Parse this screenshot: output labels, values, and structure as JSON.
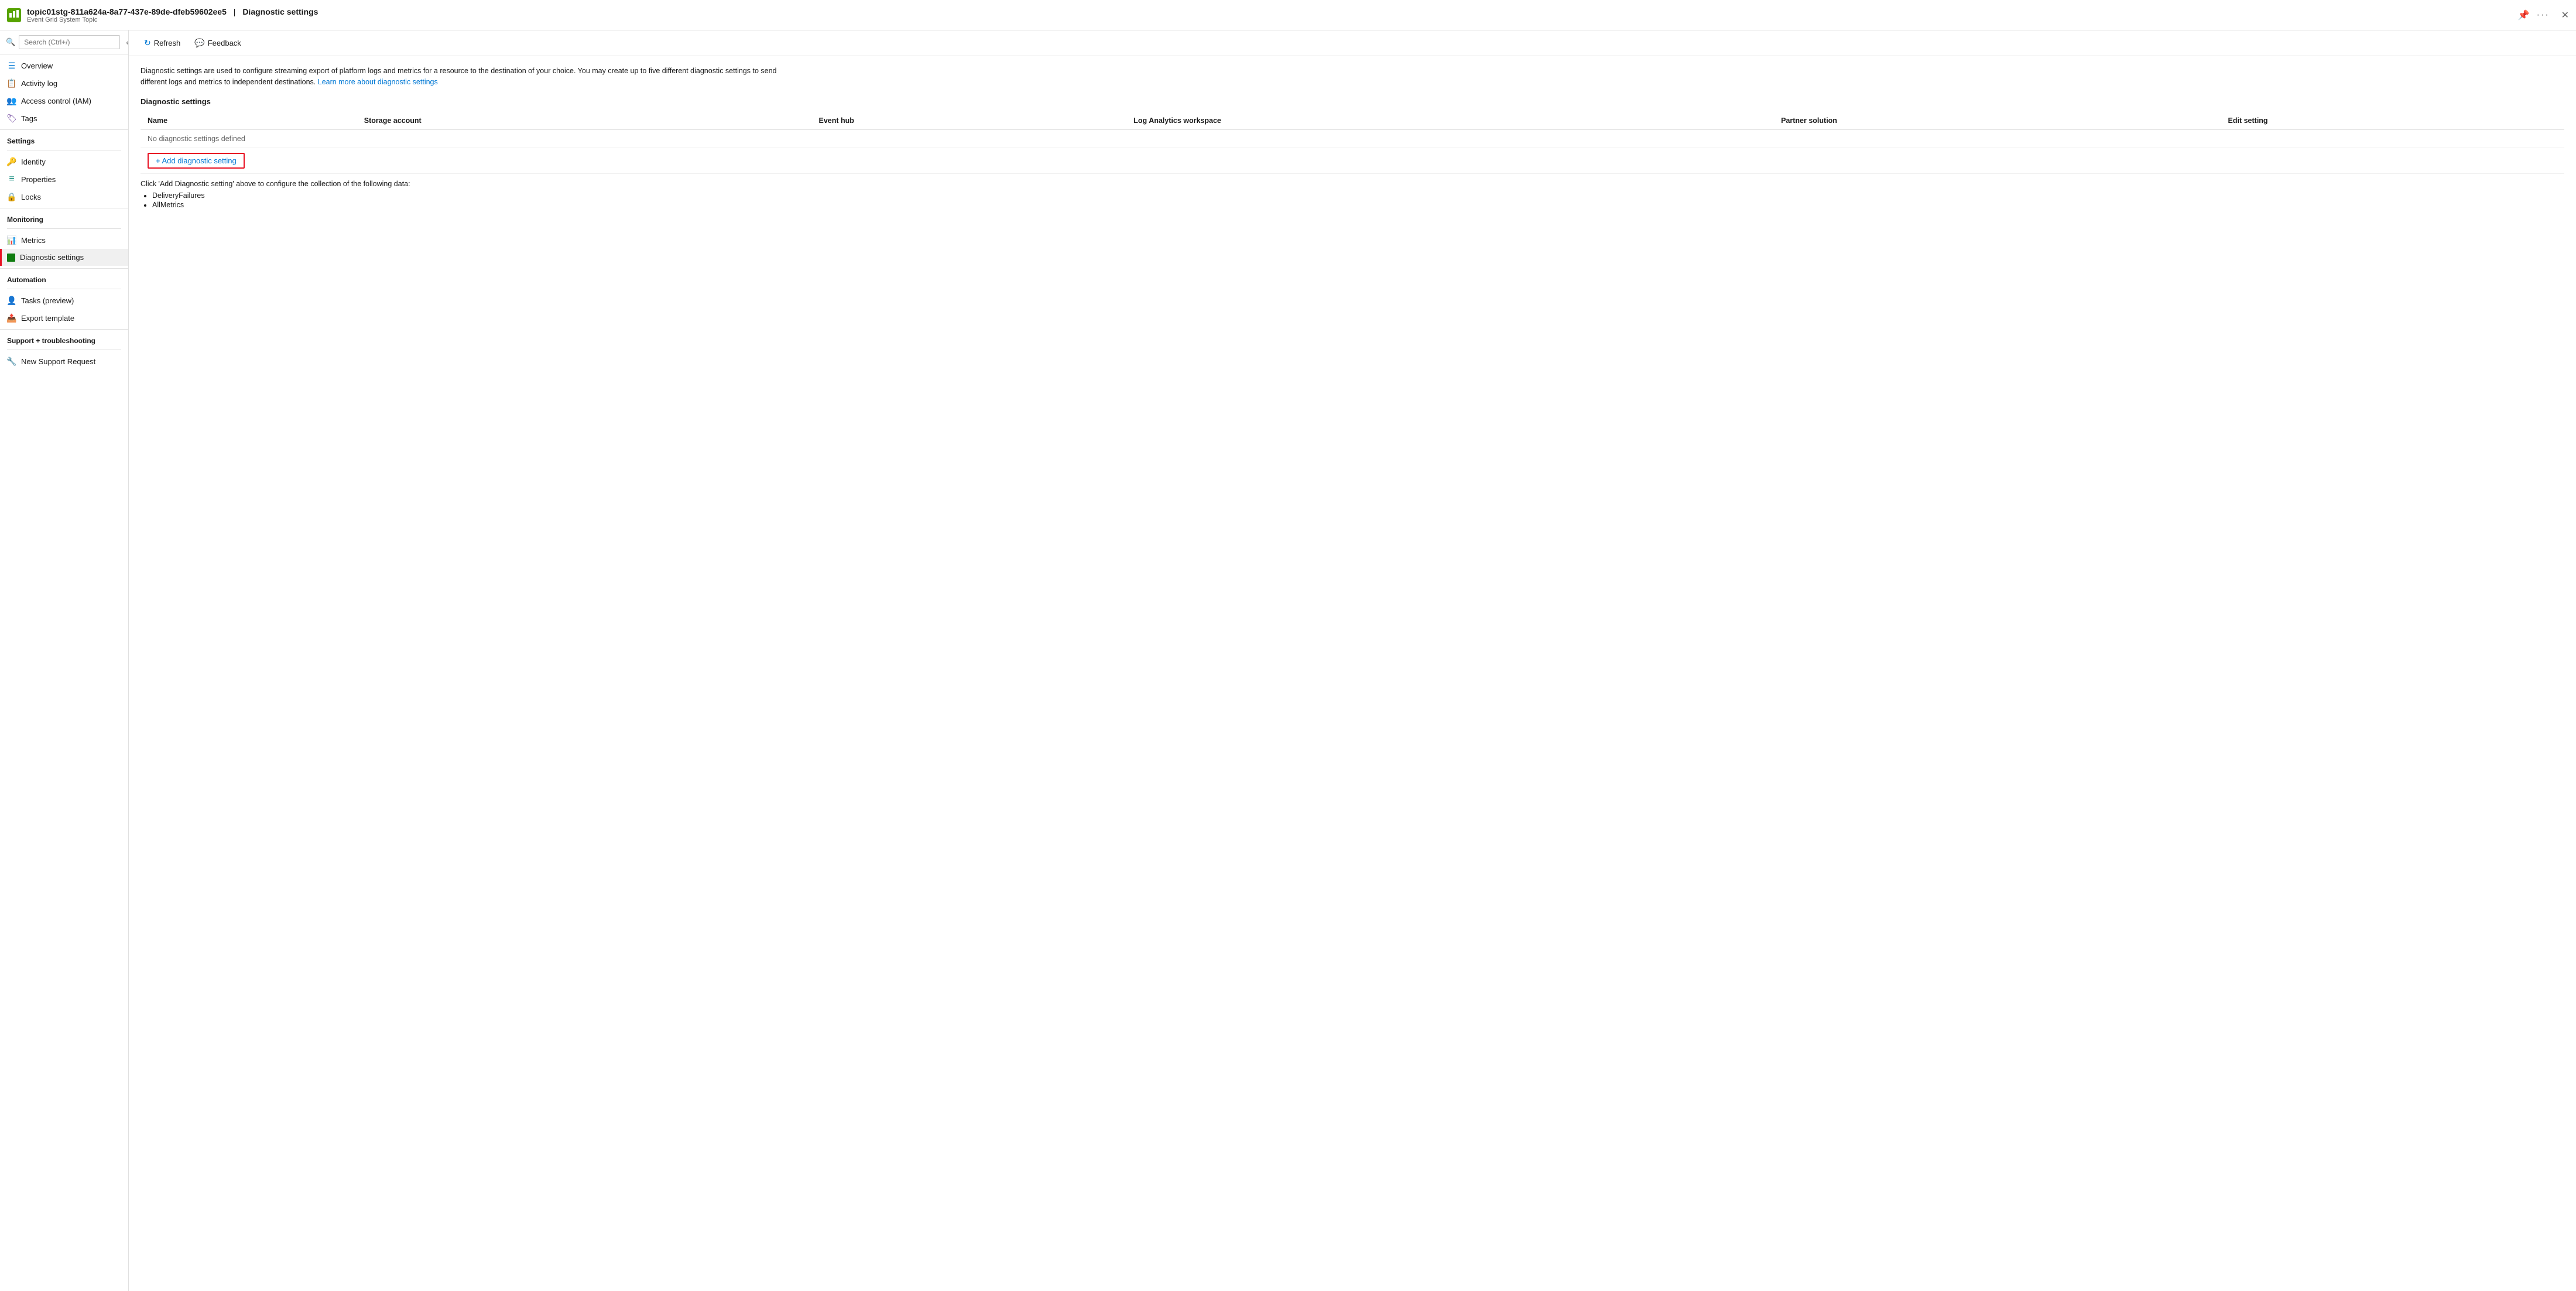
{
  "titleBar": {
    "resourceName": "topic01stg-811a624a-8a77-437e-89de-dfeb59602ee5",
    "separator": "|",
    "pageTitle": "Diagnostic settings",
    "resourceType": "Event Grid System Topic",
    "pinIcon": "📌",
    "moreIcon": "···",
    "closeIcon": "✕"
  },
  "sidebar": {
    "searchPlaceholder": "Search (Ctrl+/)",
    "items": [
      {
        "id": "overview",
        "label": "Overview",
        "icon": "☰",
        "iconColor": "icon-blue"
      },
      {
        "id": "activity-log",
        "label": "Activity log",
        "icon": "📋",
        "iconColor": "icon-blue"
      },
      {
        "id": "access-control",
        "label": "Access control (IAM)",
        "icon": "👥",
        "iconColor": "icon-blue"
      },
      {
        "id": "tags",
        "label": "Tags",
        "icon": "🏷",
        "iconColor": "icon-purple"
      }
    ],
    "sections": [
      {
        "label": "Settings",
        "items": [
          {
            "id": "identity",
            "label": "Identity",
            "icon": "🔑",
            "iconColor": "icon-yellow"
          },
          {
            "id": "properties",
            "label": "Properties",
            "icon": "≡",
            "iconColor": "icon-teal"
          },
          {
            "id": "locks",
            "label": "Locks",
            "icon": "🔒",
            "iconColor": "icon-blue"
          }
        ]
      },
      {
        "label": "Monitoring",
        "items": [
          {
            "id": "metrics",
            "label": "Metrics",
            "icon": "📊",
            "iconColor": "icon-blue"
          },
          {
            "id": "diagnostic-settings",
            "label": "Diagnostic settings",
            "icon": "▦",
            "iconColor": "icon-green",
            "active": true
          }
        ]
      },
      {
        "label": "Automation",
        "items": [
          {
            "id": "tasks",
            "label": "Tasks (preview)",
            "icon": "👤",
            "iconColor": "icon-blue"
          },
          {
            "id": "export-template",
            "label": "Export template",
            "icon": "📤",
            "iconColor": "icon-blue"
          }
        ]
      },
      {
        "label": "Support + troubleshooting",
        "items": [
          {
            "id": "new-support",
            "label": "New Support Request",
            "icon": "🔧",
            "iconColor": "icon-blue"
          }
        ]
      }
    ]
  },
  "toolbar": {
    "refreshLabel": "Refresh",
    "feedbackLabel": "Feedback"
  },
  "content": {
    "descriptionText": "Diagnostic settings are used to configure streaming export of platform logs and metrics for a resource to the destination of your choice. You may create up to five different diagnostic settings to send different logs and metrics to independent destinations.",
    "learnMoreText": "Learn more about diagnostic settings",
    "learnMoreUrl": "#",
    "sectionTitle": "Diagnostic settings",
    "tableHeaders": {
      "name": "Name",
      "storageAccount": "Storage account",
      "eventHub": "Event hub",
      "logAnalytics": "Log Analytics workspace",
      "partnerSolution": "Partner solution",
      "editSetting": "Edit setting"
    },
    "noSettingsText": "No diagnostic settings defined",
    "addSettingLabel": "+ Add diagnostic setting",
    "clickInfoText": "Click 'Add Diagnostic setting' above to configure the collection of the following data:",
    "bulletItems": [
      "DeliveryFailures",
      "AllMetrics"
    ]
  }
}
